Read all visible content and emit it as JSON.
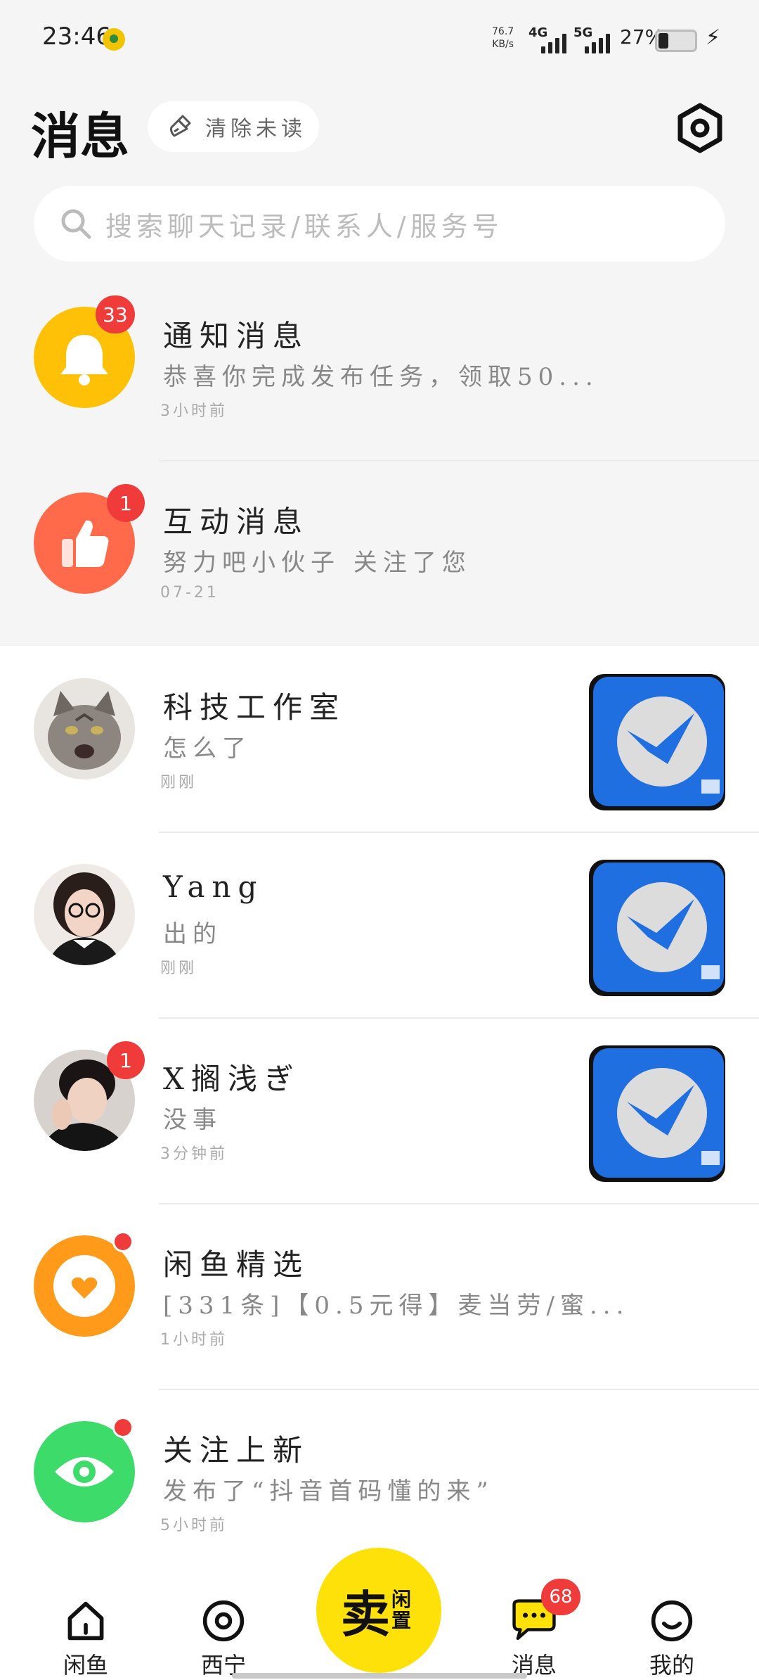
{
  "status_bar": {
    "time": "23:46",
    "speed_value": "76.7",
    "speed_unit": "KB/s",
    "net1": "4G",
    "net2": "5G",
    "battery": "27%"
  },
  "header": {
    "title": "消息",
    "clear_unread_label": "清除未读",
    "settings_icon": "settings-hex-icon"
  },
  "search": {
    "placeholder": "搜索聊天记录/联系人/服务号"
  },
  "messages": [
    {
      "title": "通知消息",
      "preview": "恭喜你完成发布任务，领取50...",
      "time": "3小时前",
      "badge": "33",
      "icon": "bell-icon",
      "color": "#ffc107"
    },
    {
      "title": "互动消息",
      "preview": "努力吧小伙子 关注了您",
      "time": "07-21",
      "badge": "1",
      "icon": "thumbs-up-icon",
      "color": "#ff6b4a"
    },
    {
      "title": "科技工作室",
      "preview": "怎么了",
      "time": "刚刚",
      "avatar": "cat-avatar",
      "thumb": "app-thumbnail"
    },
    {
      "title": "Yang",
      "preview": "出的",
      "time": "刚刚",
      "avatar": "woman-glasses-avatar",
      "thumb": "app-thumbnail"
    },
    {
      "title": "X搁浅ぎ",
      "preview": "没事",
      "time": "3分钟前",
      "badge": "1",
      "avatar": "young-man-avatar",
      "thumb": "app-thumbnail"
    },
    {
      "title": "闲鱼精选",
      "preview": "[331条]【0.5元得】麦当劳/蜜...",
      "time": "1小时前",
      "icon": "heart-icon",
      "color": "#ff9a1a"
    },
    {
      "title": "关注上新",
      "preview": "发布了“抖音首码懂的来”",
      "time": "5小时前",
      "icon": "eye-icon",
      "color": "#3ddc6a"
    }
  ],
  "bottom_nav": {
    "home": "闲鱼",
    "city": "西宁",
    "sell_main": "卖",
    "sell_side": "闲置",
    "messages": "消息",
    "messages_badge": "68",
    "mine": "我的"
  },
  "colors": {
    "accent_yellow": "#ffe10a",
    "badge_red": "#f03b3b",
    "thumb_blue": "#1f6fe0"
  }
}
